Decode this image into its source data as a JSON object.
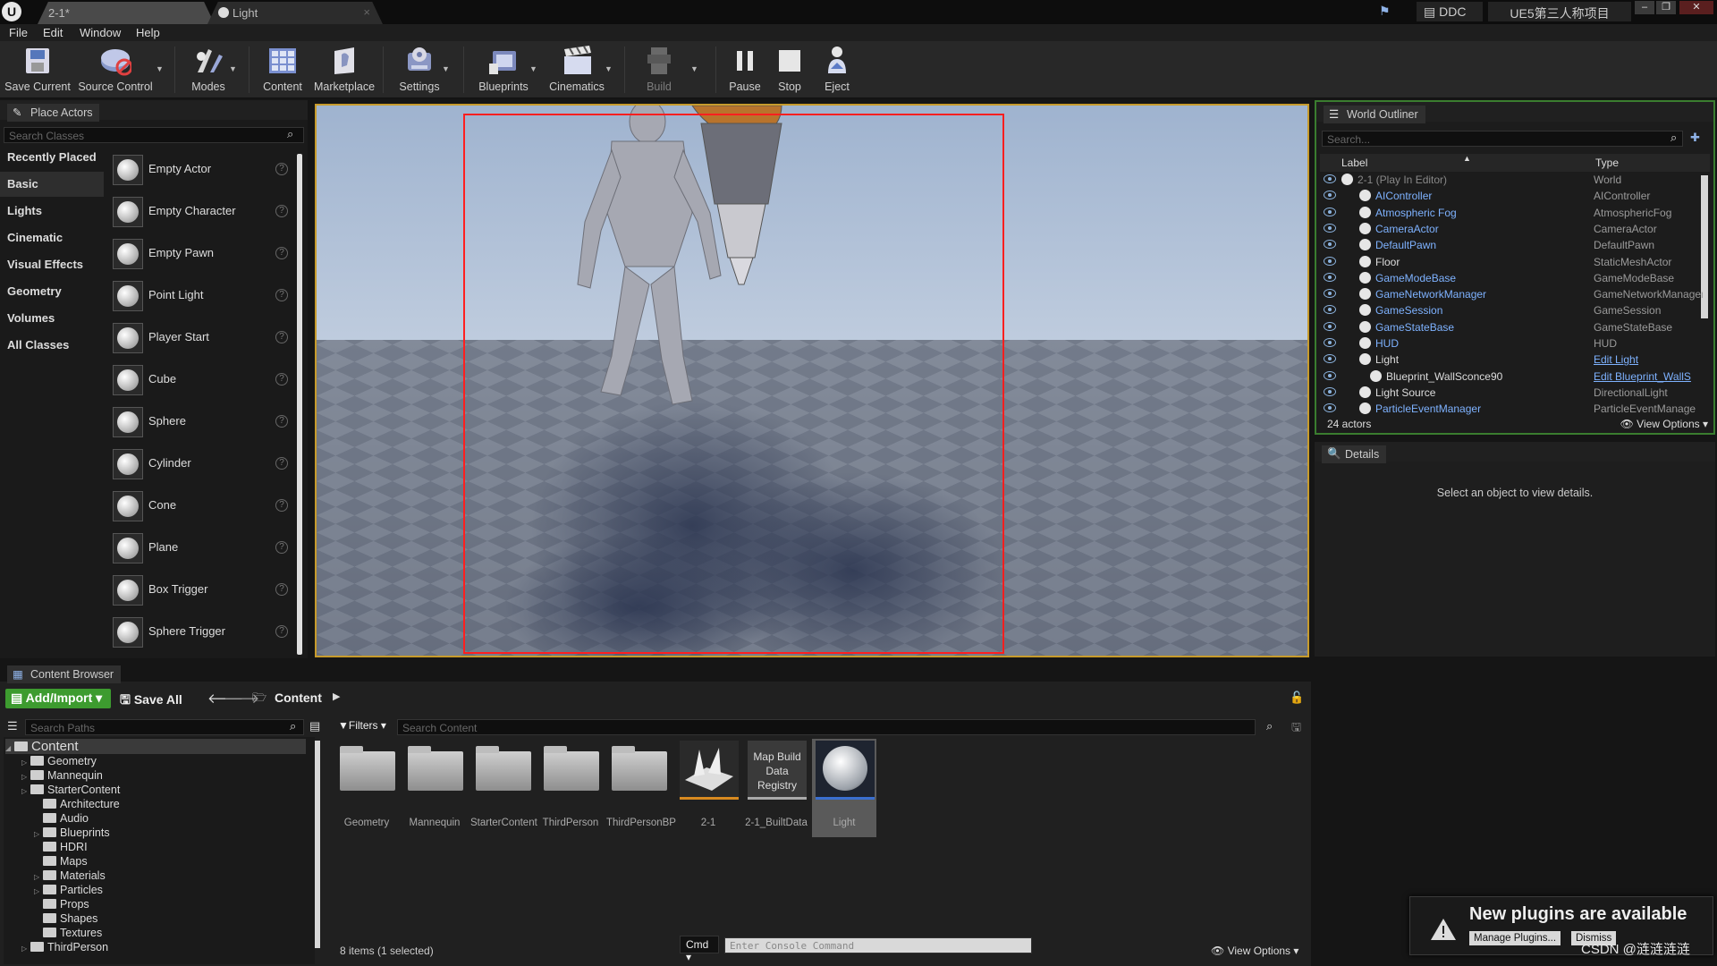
{
  "window": {
    "logo": "U",
    "tabs": [
      "2-1*",
      "Light"
    ],
    "ddc_label": "DDC",
    "project_name": "UE5第三人称项目",
    "window_controls": [
      "–",
      "❐",
      "✕"
    ]
  },
  "menu": [
    "File",
    "Edit",
    "Window",
    "Help"
  ],
  "toolbar": [
    {
      "label": "Save Current",
      "icon": "save-icon"
    },
    {
      "label": "Source Control",
      "icon": "source-control-icon"
    },
    {
      "label": "Modes",
      "icon": "modes-icon"
    },
    {
      "label": "Content",
      "icon": "content-icon"
    },
    {
      "label": "Marketplace",
      "icon": "marketplace-icon"
    },
    {
      "label": "Settings",
      "icon": "settings-icon"
    },
    {
      "label": "Blueprints",
      "icon": "blueprints-icon"
    },
    {
      "label": "Cinematics",
      "icon": "cinematics-icon"
    },
    {
      "label": "Build",
      "icon": "build-icon"
    },
    {
      "label": "Pause",
      "icon": "pause-icon"
    },
    {
      "label": "Stop",
      "icon": "stop-icon"
    },
    {
      "label": "Eject",
      "icon": "eject-icon"
    }
  ],
  "place_actors": {
    "title": "Place Actors",
    "search_placeholder": "Search Classes",
    "categories": [
      "Recently Placed",
      "Basic",
      "Lights",
      "Cinematic",
      "Visual Effects",
      "Geometry",
      "Volumes",
      "All Classes"
    ],
    "selected_category": "Basic",
    "actors": [
      "Empty Actor",
      "Empty Character",
      "Empty Pawn",
      "Point Light",
      "Player Start",
      "Cube",
      "Sphere",
      "Cylinder",
      "Cone",
      "Plane",
      "Box Trigger",
      "Sphere Trigger"
    ],
    "help_glyph": "?"
  },
  "outliner": {
    "title": "World Outliner",
    "search_placeholder": "Search...",
    "col_label": "Label",
    "col_type": "Type",
    "rows": [
      {
        "label": "2-1 (Play In Editor)",
        "type": "World"
      },
      {
        "label": "AIController",
        "type": "AIController"
      },
      {
        "label": "Atmospheric Fog",
        "type": "AtmosphericFog"
      },
      {
        "label": "CameraActor",
        "type": "CameraActor"
      },
      {
        "label": "DefaultPawn",
        "type": "DefaultPawn"
      },
      {
        "label": "Floor",
        "type": "StaticMeshActor"
      },
      {
        "label": "GameModeBase",
        "type": "GameModeBase"
      },
      {
        "label": "GameNetworkManager",
        "type": "GameNetworkManager"
      },
      {
        "label": "GameSession",
        "type": "GameSession"
      },
      {
        "label": "GameStateBase",
        "type": "GameStateBase"
      },
      {
        "label": "HUD",
        "type": "HUD"
      },
      {
        "label": "Light",
        "type": "Edit Light"
      },
      {
        "label": "Blueprint_WallSconce90",
        "type": "Edit Blueprint_WallS"
      },
      {
        "label": "Light Source",
        "type": "DirectionalLight"
      },
      {
        "label": "ParticleEventManager",
        "type": "ParticleEventManage"
      }
    ],
    "actor_count": "24 actors",
    "view_options": "View Options"
  },
  "details": {
    "title": "Details",
    "empty_text": "Select an object to view details."
  },
  "content_browser": {
    "title": "Content Browser",
    "add_import": "Add/Import",
    "save_all": "Save All",
    "path": "Content",
    "search_paths_placeholder": "Search Paths",
    "filters": "Filters",
    "search_content_placeholder": "Search Content",
    "tree": [
      {
        "label": "Content",
        "depth": 0
      },
      {
        "label": "Geometry",
        "depth": 1
      },
      {
        "label": "Mannequin",
        "depth": 1
      },
      {
        "label": "StarterContent",
        "depth": 1
      },
      {
        "label": "Architecture",
        "depth": 2
      },
      {
        "label": "Audio",
        "depth": 2
      },
      {
        "label": "Blueprints",
        "depth": 2
      },
      {
        "label": "HDRI",
        "depth": 2
      },
      {
        "label": "Maps",
        "depth": 2
      },
      {
        "label": "Materials",
        "depth": 2
      },
      {
        "label": "Particles",
        "depth": 2
      },
      {
        "label": "Props",
        "depth": 2
      },
      {
        "label": "Shapes",
        "depth": 2
      },
      {
        "label": "Textures",
        "depth": 2
      },
      {
        "label": "ThirdPerson",
        "depth": 1
      }
    ],
    "assets": [
      "Geometry",
      "Mannequin",
      "StarterContent",
      "ThirdPerson",
      "ThirdPersonBP",
      "2-1",
      "2-1_BuiltData",
      "Light"
    ],
    "map_build_thumb": "Map Build Data Registry",
    "selected_asset": "Light",
    "status": "8 items (1 selected)",
    "cmd_label": "Cmd",
    "console_placeholder": "Enter Console Command",
    "view_options": "View Options"
  },
  "notification": {
    "title": "New plugins are available",
    "manage": "Manage Plugins...",
    "dismiss": "Dismiss"
  },
  "watermark": "CSDN @涟涟涟涟"
}
